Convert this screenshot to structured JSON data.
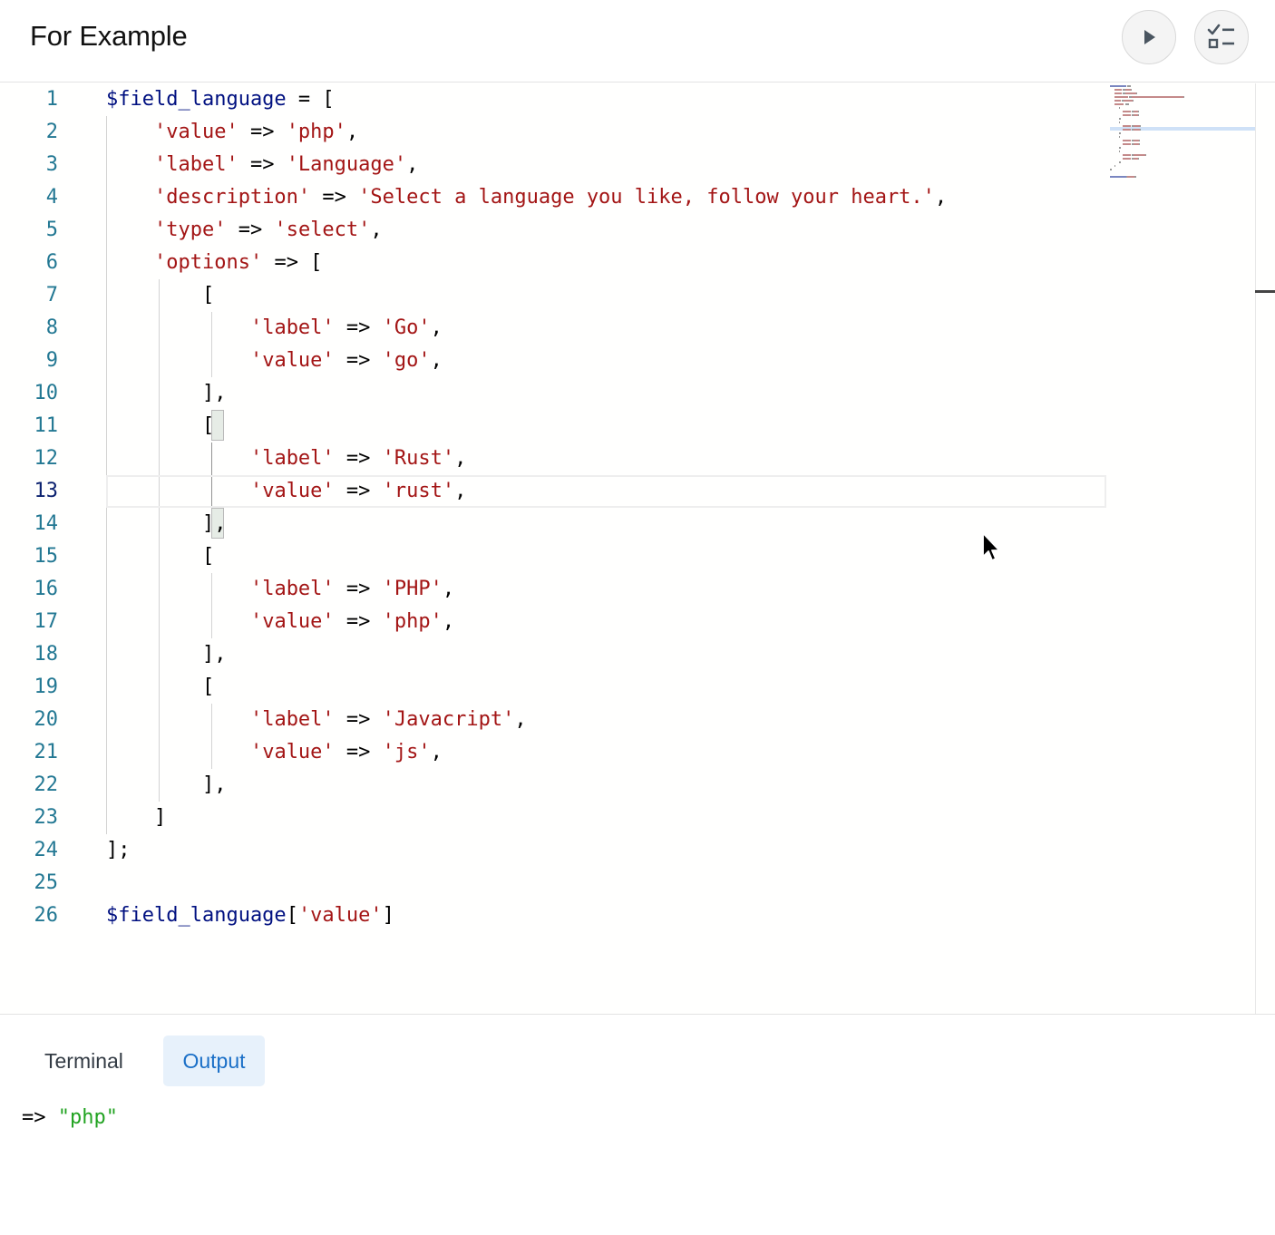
{
  "header": {
    "title": "For Example",
    "run_button_icon": "play-icon",
    "checklist_button_icon": "checklist-icon"
  },
  "editor": {
    "active_line": 13,
    "lines": [
      {
        "n": "1",
        "tokens": [
          {
            "t": "$field_language",
            "c": "v"
          },
          {
            "t": " = [",
            "c": "p"
          }
        ]
      },
      {
        "n": "2",
        "tokens": [
          {
            "t": "    ",
            "c": "p"
          },
          {
            "t": "'value'",
            "c": "s"
          },
          {
            "t": " => ",
            "c": "p"
          },
          {
            "t": "'php'",
            "c": "s"
          },
          {
            "t": ",",
            "c": "p"
          }
        ]
      },
      {
        "n": "3",
        "tokens": [
          {
            "t": "    ",
            "c": "p"
          },
          {
            "t": "'label'",
            "c": "s"
          },
          {
            "t": " => ",
            "c": "p"
          },
          {
            "t": "'Language'",
            "c": "s"
          },
          {
            "t": ",",
            "c": "p"
          }
        ]
      },
      {
        "n": "4",
        "tokens": [
          {
            "t": "    ",
            "c": "p"
          },
          {
            "t": "'description'",
            "c": "s"
          },
          {
            "t": " => ",
            "c": "p"
          },
          {
            "t": "'Select a language you like, follow your heart.'",
            "c": "s"
          },
          {
            "t": ",",
            "c": "p"
          }
        ]
      },
      {
        "n": "5",
        "tokens": [
          {
            "t": "    ",
            "c": "p"
          },
          {
            "t": "'type'",
            "c": "s"
          },
          {
            "t": " => ",
            "c": "p"
          },
          {
            "t": "'select'",
            "c": "s"
          },
          {
            "t": ",",
            "c": "p"
          }
        ]
      },
      {
        "n": "6",
        "tokens": [
          {
            "t": "    ",
            "c": "p"
          },
          {
            "t": "'options'",
            "c": "s"
          },
          {
            "t": " => [",
            "c": "p"
          }
        ]
      },
      {
        "n": "7",
        "tokens": [
          {
            "t": "        [",
            "c": "p"
          }
        ]
      },
      {
        "n": "8",
        "tokens": [
          {
            "t": "            ",
            "c": "p"
          },
          {
            "t": "'label'",
            "c": "s"
          },
          {
            "t": " => ",
            "c": "p"
          },
          {
            "t": "'Go'",
            "c": "s"
          },
          {
            "t": ",",
            "c": "p"
          }
        ]
      },
      {
        "n": "9",
        "tokens": [
          {
            "t": "            ",
            "c": "p"
          },
          {
            "t": "'value'",
            "c": "s"
          },
          {
            "t": " => ",
            "c": "p"
          },
          {
            "t": "'go'",
            "c": "s"
          },
          {
            "t": ",",
            "c": "p"
          }
        ]
      },
      {
        "n": "10",
        "tokens": [
          {
            "t": "        ],",
            "c": "p"
          }
        ]
      },
      {
        "n": "11",
        "tokens": [
          {
            "t": "        [",
            "c": "p"
          }
        ]
      },
      {
        "n": "12",
        "tokens": [
          {
            "t": "            ",
            "c": "p"
          },
          {
            "t": "'label'",
            "c": "s"
          },
          {
            "t": " => ",
            "c": "p"
          },
          {
            "t": "'Rust'",
            "c": "s"
          },
          {
            "t": ",",
            "c": "p"
          }
        ]
      },
      {
        "n": "13",
        "tokens": [
          {
            "t": "            ",
            "c": "p"
          },
          {
            "t": "'value'",
            "c": "s"
          },
          {
            "t": " => ",
            "c": "p"
          },
          {
            "t": "'rust'",
            "c": "s"
          },
          {
            "t": ",",
            "c": "p"
          }
        ]
      },
      {
        "n": "14",
        "tokens": [
          {
            "t": "        ],",
            "c": "p"
          }
        ]
      },
      {
        "n": "15",
        "tokens": [
          {
            "t": "        [",
            "c": "p"
          }
        ]
      },
      {
        "n": "16",
        "tokens": [
          {
            "t": "            ",
            "c": "p"
          },
          {
            "t": "'label'",
            "c": "s"
          },
          {
            "t": " => ",
            "c": "p"
          },
          {
            "t": "'PHP'",
            "c": "s"
          },
          {
            "t": ",",
            "c": "p"
          }
        ]
      },
      {
        "n": "17",
        "tokens": [
          {
            "t": "            ",
            "c": "p"
          },
          {
            "t": "'value'",
            "c": "s"
          },
          {
            "t": " => ",
            "c": "p"
          },
          {
            "t": "'php'",
            "c": "s"
          },
          {
            "t": ",",
            "c": "p"
          }
        ]
      },
      {
        "n": "18",
        "tokens": [
          {
            "t": "        ],",
            "c": "p"
          }
        ]
      },
      {
        "n": "19",
        "tokens": [
          {
            "t": "        [",
            "c": "p"
          }
        ]
      },
      {
        "n": "20",
        "tokens": [
          {
            "t": "            ",
            "c": "p"
          },
          {
            "t": "'label'",
            "c": "s"
          },
          {
            "t": " => ",
            "c": "p"
          },
          {
            "t": "'Javacript'",
            "c": "s"
          },
          {
            "t": ",",
            "c": "p"
          }
        ]
      },
      {
        "n": "21",
        "tokens": [
          {
            "t": "            ",
            "c": "p"
          },
          {
            "t": "'value'",
            "c": "s"
          },
          {
            "t": " => ",
            "c": "p"
          },
          {
            "t": "'js'",
            "c": "s"
          },
          {
            "t": ",",
            "c": "p"
          }
        ]
      },
      {
        "n": "22",
        "tokens": [
          {
            "t": "        ],",
            "c": "p"
          }
        ]
      },
      {
        "n": "23",
        "tokens": [
          {
            "t": "    ]",
            "c": "p"
          }
        ]
      },
      {
        "n": "24",
        "tokens": [
          {
            "t": "];",
            "c": "p"
          }
        ]
      },
      {
        "n": "25",
        "tokens": []
      },
      {
        "n": "26",
        "tokens": [
          {
            "t": "$field_language",
            "c": "v"
          },
          {
            "t": "[",
            "c": "p"
          },
          {
            "t": "'value'",
            "c": "s"
          },
          {
            "t": "]",
            "c": "p"
          }
        ]
      }
    ]
  },
  "panel": {
    "tabs": [
      {
        "label": "Terminal",
        "active": false
      },
      {
        "label": "Output",
        "active": true
      }
    ],
    "output_prefix": "=> ",
    "output_value": "\"php\""
  },
  "colors": {
    "variable": "#001080",
    "string": "#a31515",
    "line_number": "#237893",
    "accent": "#1a6fc7",
    "output_string": "#22a322"
  }
}
